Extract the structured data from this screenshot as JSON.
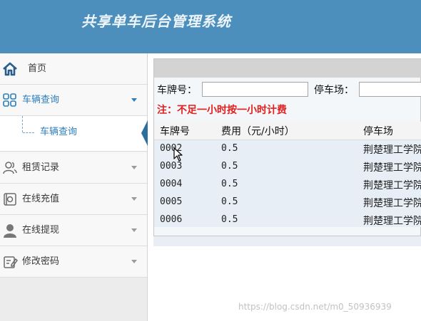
{
  "header": {
    "title": "共享单车后台管理系统"
  },
  "sidebar": {
    "items": [
      {
        "label": "首页",
        "icon": "home-icon"
      },
      {
        "label": "车辆查询",
        "icon": "grid-icon"
      },
      {
        "label": "租赁记录",
        "icon": "users-icon"
      },
      {
        "label": "在线充值",
        "icon": "card-icon"
      },
      {
        "label": "在线提现",
        "icon": "user-icon"
      },
      {
        "label": "修改密码",
        "icon": "edit-icon"
      }
    ],
    "submenu": {
      "label": "车辆查询"
    }
  },
  "search": {
    "plate_label": "车牌号：",
    "plate_value": "",
    "lot_label": "停车场：",
    "lot_value": ""
  },
  "notice": "注：不足一小时按一小时计费",
  "table": {
    "headers": [
      "车牌号",
      "费用（元/小时）",
      "停车场"
    ],
    "rows": [
      {
        "plate": "0002",
        "fee": "0.5",
        "lot": "荆楚理工学院"
      },
      {
        "plate": "0003",
        "fee": "0.5",
        "lot": "荆楚理工学院"
      },
      {
        "plate": "0004",
        "fee": "0.5",
        "lot": "荆楚理工学院"
      },
      {
        "plate": "0005",
        "fee": "0.5",
        "lot": "荆楚理工学院"
      },
      {
        "plate": "0006",
        "fee": "0.5",
        "lot": "荆楚理工学院"
      }
    ]
  },
  "watermark": "https://blog.csdn.net/m0_50936939",
  "colors": {
    "header": "#4d8fbc",
    "accent": "#2b7dbc",
    "notice": "#e0201f"
  }
}
